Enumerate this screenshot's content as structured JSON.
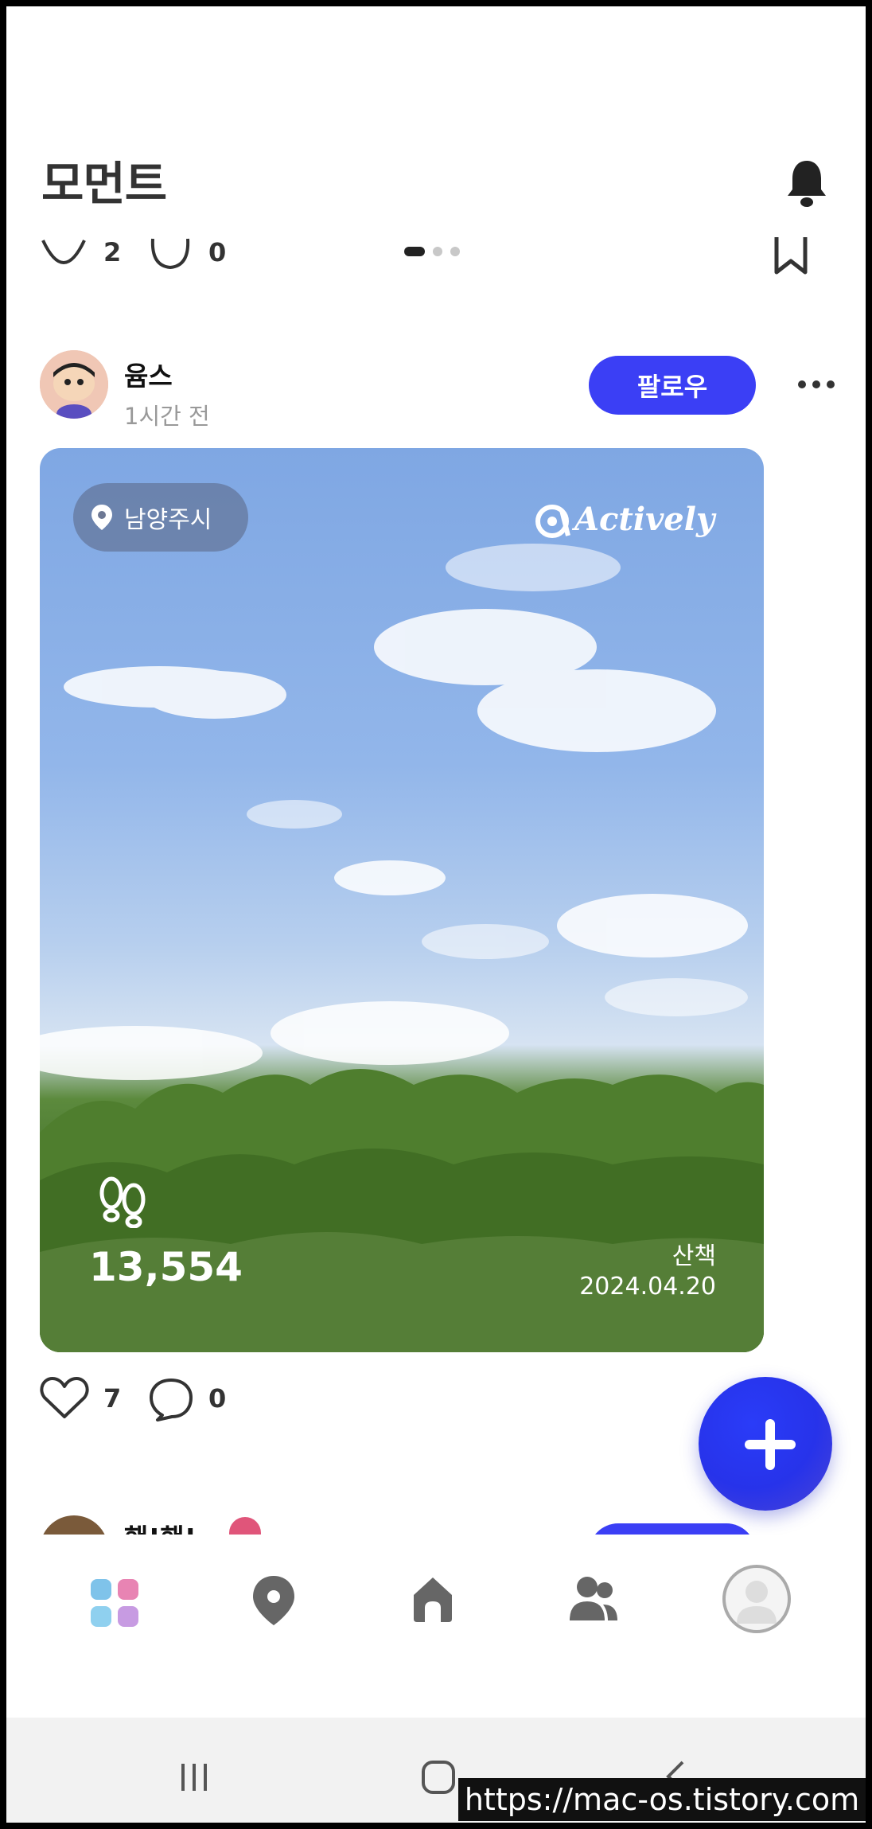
{
  "header": {
    "title": "모먼트"
  },
  "previous_post": {
    "likes": "2",
    "comments": "0"
  },
  "post": {
    "author": "윰스",
    "time": "1시간 전",
    "follow_label": "팔로우",
    "location": "남양주시",
    "brand": "Actively",
    "steps": "13,554",
    "activity": "산책",
    "date": "2024.04.20",
    "likes": "7",
    "comments": "0"
  },
  "next_post": {
    "author": "핸!핸!"
  },
  "nav": [
    "grid-tab",
    "map-tab",
    "home-tab",
    "friends-tab",
    "profile-tab"
  ],
  "colors": {
    "accent": "#3b3ff5",
    "icon": "#666666"
  },
  "watermark": "https://mac-os.tistory.com"
}
